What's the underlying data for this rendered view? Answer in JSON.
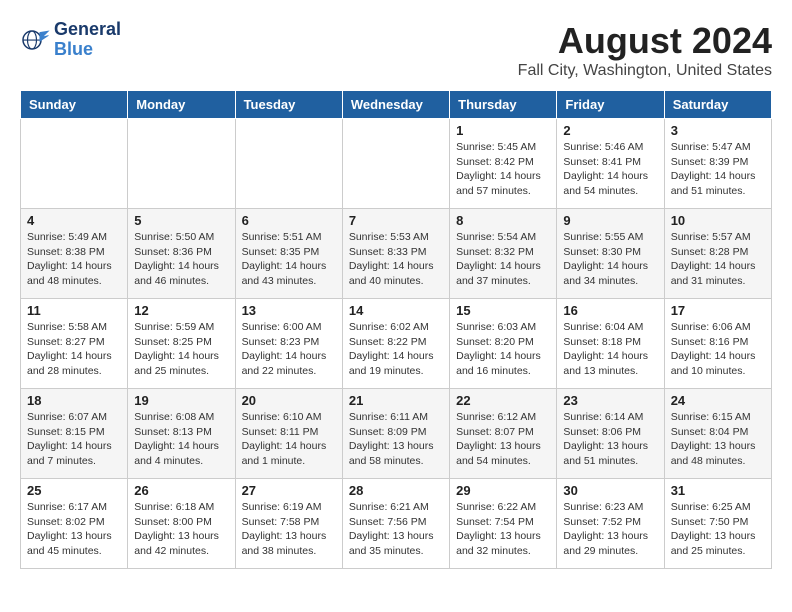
{
  "header": {
    "logo_line1": "General",
    "logo_line2": "Blue",
    "title": "August 2024",
    "subtitle": "Fall City, Washington, United States"
  },
  "weekdays": [
    "Sunday",
    "Monday",
    "Tuesday",
    "Wednesday",
    "Thursday",
    "Friday",
    "Saturday"
  ],
  "weeks": [
    [
      {
        "day": "",
        "info": ""
      },
      {
        "day": "",
        "info": ""
      },
      {
        "day": "",
        "info": ""
      },
      {
        "day": "",
        "info": ""
      },
      {
        "day": "1",
        "info": "Sunrise: 5:45 AM\nSunset: 8:42 PM\nDaylight: 14 hours\nand 57 minutes."
      },
      {
        "day": "2",
        "info": "Sunrise: 5:46 AM\nSunset: 8:41 PM\nDaylight: 14 hours\nand 54 minutes."
      },
      {
        "day": "3",
        "info": "Sunrise: 5:47 AM\nSunset: 8:39 PM\nDaylight: 14 hours\nand 51 minutes."
      }
    ],
    [
      {
        "day": "4",
        "info": "Sunrise: 5:49 AM\nSunset: 8:38 PM\nDaylight: 14 hours\nand 48 minutes."
      },
      {
        "day": "5",
        "info": "Sunrise: 5:50 AM\nSunset: 8:36 PM\nDaylight: 14 hours\nand 46 minutes."
      },
      {
        "day": "6",
        "info": "Sunrise: 5:51 AM\nSunset: 8:35 PM\nDaylight: 14 hours\nand 43 minutes."
      },
      {
        "day": "7",
        "info": "Sunrise: 5:53 AM\nSunset: 8:33 PM\nDaylight: 14 hours\nand 40 minutes."
      },
      {
        "day": "8",
        "info": "Sunrise: 5:54 AM\nSunset: 8:32 PM\nDaylight: 14 hours\nand 37 minutes."
      },
      {
        "day": "9",
        "info": "Sunrise: 5:55 AM\nSunset: 8:30 PM\nDaylight: 14 hours\nand 34 minutes."
      },
      {
        "day": "10",
        "info": "Sunrise: 5:57 AM\nSunset: 8:28 PM\nDaylight: 14 hours\nand 31 minutes."
      }
    ],
    [
      {
        "day": "11",
        "info": "Sunrise: 5:58 AM\nSunset: 8:27 PM\nDaylight: 14 hours\nand 28 minutes."
      },
      {
        "day": "12",
        "info": "Sunrise: 5:59 AM\nSunset: 8:25 PM\nDaylight: 14 hours\nand 25 minutes."
      },
      {
        "day": "13",
        "info": "Sunrise: 6:00 AM\nSunset: 8:23 PM\nDaylight: 14 hours\nand 22 minutes."
      },
      {
        "day": "14",
        "info": "Sunrise: 6:02 AM\nSunset: 8:22 PM\nDaylight: 14 hours\nand 19 minutes."
      },
      {
        "day": "15",
        "info": "Sunrise: 6:03 AM\nSunset: 8:20 PM\nDaylight: 14 hours\nand 16 minutes."
      },
      {
        "day": "16",
        "info": "Sunrise: 6:04 AM\nSunset: 8:18 PM\nDaylight: 14 hours\nand 13 minutes."
      },
      {
        "day": "17",
        "info": "Sunrise: 6:06 AM\nSunset: 8:16 PM\nDaylight: 14 hours\nand 10 minutes."
      }
    ],
    [
      {
        "day": "18",
        "info": "Sunrise: 6:07 AM\nSunset: 8:15 PM\nDaylight: 14 hours\nand 7 minutes."
      },
      {
        "day": "19",
        "info": "Sunrise: 6:08 AM\nSunset: 8:13 PM\nDaylight: 14 hours\nand 4 minutes."
      },
      {
        "day": "20",
        "info": "Sunrise: 6:10 AM\nSunset: 8:11 PM\nDaylight: 14 hours\nand 1 minute."
      },
      {
        "day": "21",
        "info": "Sunrise: 6:11 AM\nSunset: 8:09 PM\nDaylight: 13 hours\nand 58 minutes."
      },
      {
        "day": "22",
        "info": "Sunrise: 6:12 AM\nSunset: 8:07 PM\nDaylight: 13 hours\nand 54 minutes."
      },
      {
        "day": "23",
        "info": "Sunrise: 6:14 AM\nSunset: 8:06 PM\nDaylight: 13 hours\nand 51 minutes."
      },
      {
        "day": "24",
        "info": "Sunrise: 6:15 AM\nSunset: 8:04 PM\nDaylight: 13 hours\nand 48 minutes."
      }
    ],
    [
      {
        "day": "25",
        "info": "Sunrise: 6:17 AM\nSunset: 8:02 PM\nDaylight: 13 hours\nand 45 minutes."
      },
      {
        "day": "26",
        "info": "Sunrise: 6:18 AM\nSunset: 8:00 PM\nDaylight: 13 hours\nand 42 minutes."
      },
      {
        "day": "27",
        "info": "Sunrise: 6:19 AM\nSunset: 7:58 PM\nDaylight: 13 hours\nand 38 minutes."
      },
      {
        "day": "28",
        "info": "Sunrise: 6:21 AM\nSunset: 7:56 PM\nDaylight: 13 hours\nand 35 minutes."
      },
      {
        "day": "29",
        "info": "Sunrise: 6:22 AM\nSunset: 7:54 PM\nDaylight: 13 hours\nand 32 minutes."
      },
      {
        "day": "30",
        "info": "Sunrise: 6:23 AM\nSunset: 7:52 PM\nDaylight: 13 hours\nand 29 minutes."
      },
      {
        "day": "31",
        "info": "Sunrise: 6:25 AM\nSunset: 7:50 PM\nDaylight: 13 hours\nand 25 minutes."
      }
    ]
  ]
}
